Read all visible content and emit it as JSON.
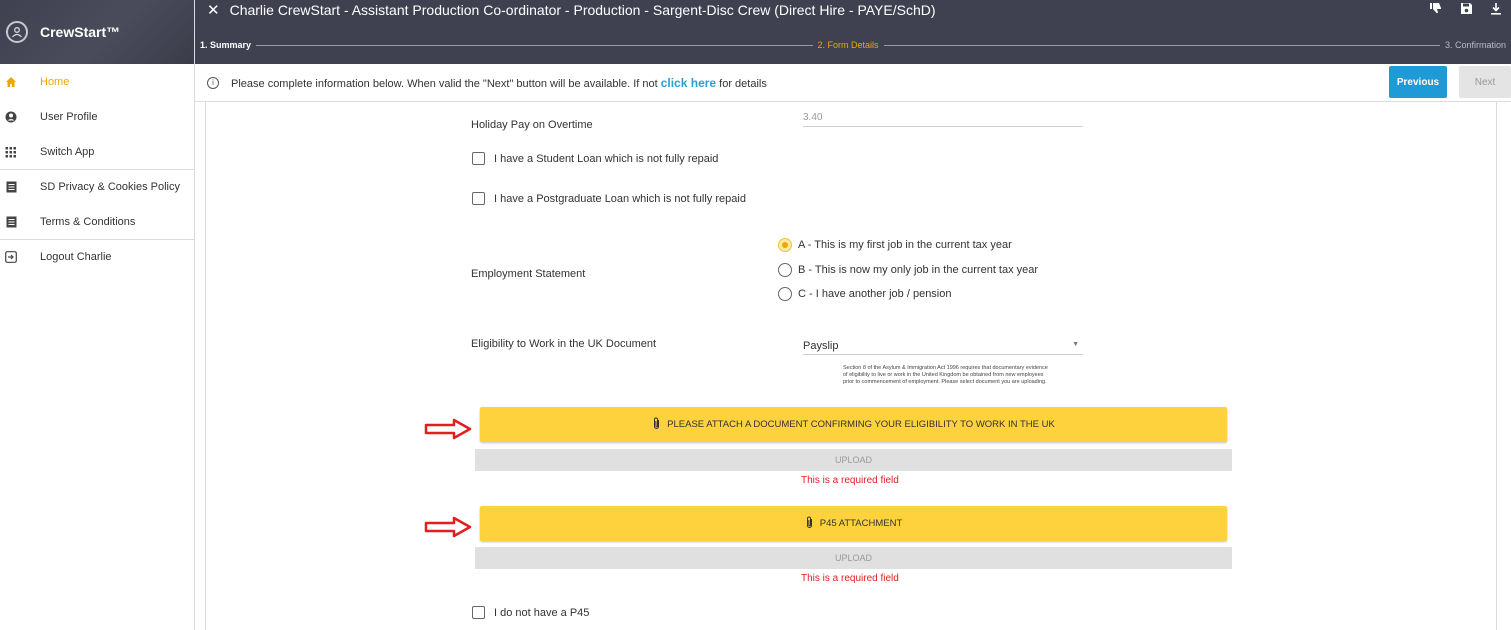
{
  "app": {
    "brand": "CrewStart™"
  },
  "sidebar": {
    "items": [
      {
        "label": "Home",
        "icon": "home-icon",
        "active": true
      },
      {
        "label": "User Profile",
        "icon": "user-icon"
      },
      {
        "label": "Switch App",
        "icon": "grid-icon"
      },
      {
        "label": "SD Privacy & Cookies Policy",
        "icon": "document-icon"
      },
      {
        "label": "Terms & Conditions",
        "icon": "document-icon"
      },
      {
        "label": "Logout Charlie",
        "icon": "logout-icon"
      }
    ]
  },
  "header": {
    "close_symbol": "✕",
    "title": "Charlie CrewStart - Assistant Production Co-ordinator - Production - Sargent-Disc Crew (Direct Hire - PAYE/SchD)",
    "steps": [
      {
        "label": "1. Summary",
        "state": "done"
      },
      {
        "label": "2. Form Details",
        "state": "current"
      },
      {
        "label": "3. Confirmation",
        "state": "future"
      }
    ],
    "icons": [
      "thumbs-down-icon",
      "save-icon",
      "download-icon"
    ]
  },
  "infobar": {
    "message": "Please complete information below. When valid the \"Next\" button will be available. If not",
    "link": "click here",
    "suffix": "for details",
    "previous_label": "Previous",
    "next_label": "Next"
  },
  "form": {
    "holiday_pay_label": "Holiday Pay on Overtime",
    "holiday_pay_value": "3.40",
    "student_loan_label": "I have a Student Loan which is not fully repaid",
    "postgrad_loan_label": "I have a Postgraduate Loan which is not fully repaid",
    "employment_statement_label": "Employment Statement",
    "employment_options": [
      {
        "label": "A - This is my first job in the current tax year",
        "selected": true
      },
      {
        "label": "B - This is now my only job in the current tax year",
        "selected": false
      },
      {
        "label": "C - I have another job / pension",
        "selected": false
      }
    ],
    "eligibility_label": "Eligibility to Work in the UK Document",
    "eligibility_value": "Payslip",
    "eligibility_note": "Section 8 of the Asylum & Immigration Act 1996 requires that documentary evidence of eligibility to live or work in the United Kingdom be obtained from new employees prior to commencement of employment. Please select document you are uploading.",
    "attach_eligibility_label": "PLEASE ATTACH A DOCUMENT CONFIRMING YOUR ELIGIBILITY TO WORK IN THE UK",
    "upload_label": "UPLOAD",
    "required_text": "This is a required field",
    "p45_label": "P45 ATTACHMENT",
    "no_p45_label": "I do not have a P45"
  },
  "colors": {
    "header_bg": "#3f4150",
    "accent": "#f0a500",
    "attach_button": "#fdd23c",
    "previous_button": "#1e9bd7",
    "error": "#e02020",
    "annotation_arrow": "#e02020"
  }
}
